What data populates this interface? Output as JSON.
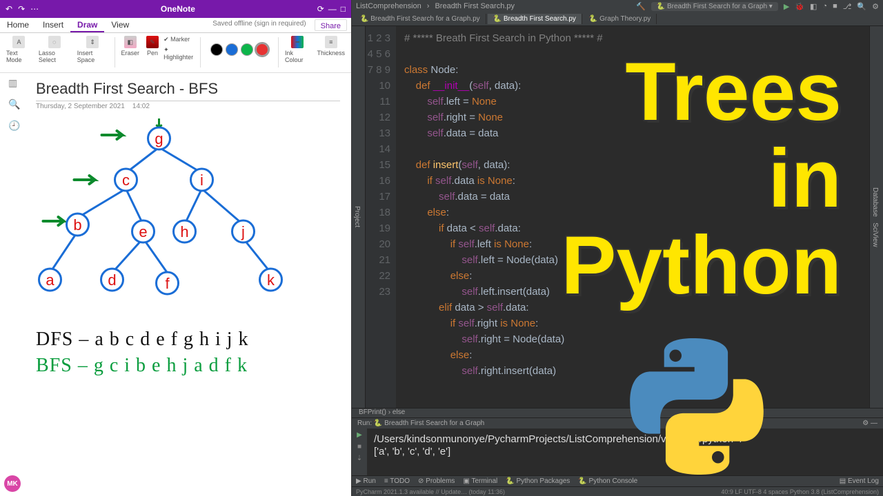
{
  "onenote": {
    "app_title": "OneNote",
    "tabs": [
      "Home",
      "Insert",
      "Draw",
      "View"
    ],
    "active_tab": "Draw",
    "save_status": "Saved offline (sign in required)",
    "share_label": "Share",
    "ribbon": {
      "text_mode": "Text Mode",
      "lasso": "Lasso Select",
      "insert_space": "Insert Space",
      "eraser": "Eraser",
      "pen": "Pen",
      "marker": "Marker",
      "highlighter": "Highlighter",
      "ink_colour": "Ink Colour",
      "thickness": "Thickness",
      "colors": [
        "#000000",
        "#1a6dd6",
        "#0db54b",
        "#e73232"
      ]
    },
    "note": {
      "title": "Breadth First Search - BFS",
      "date": "Thursday, 2 September 2021",
      "time": "14:02",
      "tree_nodes": [
        "g",
        "c",
        "i",
        "b",
        "e",
        "h",
        "j",
        "a",
        "d",
        "f",
        "k"
      ],
      "dfs_line": "DFS – a b c d e f g h i j k",
      "bfs_line": "BFS – g c i b e h j a d f k"
    },
    "user_initials": "MK"
  },
  "ide": {
    "crumb1": "ListComprehension",
    "crumb2": "Breadth First Search.py",
    "run_config": "Breadth First Search for a Graph",
    "tabs": [
      {
        "label": "Breadth First Search for a Graph.py",
        "active": false
      },
      {
        "label": "Breadth First Search.py",
        "active": true
      },
      {
        "label": "Graph Theory.py",
        "active": false
      }
    ],
    "left_gutter": "Project",
    "right_gutters": [
      "Database",
      "SciView"
    ],
    "code_lines": [
      {
        "n": 1,
        "html": "<span class='cmt'># ***** Breath First Search in Python ***** #</span>"
      },
      {
        "n": 2,
        "html": ""
      },
      {
        "n": 3,
        "html": "<span class='kw'>class</span> Node:"
      },
      {
        "n": 4,
        "html": "    <span class='kw'>def</span> <span class='mg'>__init__</span>(<span class='slf'>self</span>, data):"
      },
      {
        "n": 5,
        "html": "        <span class='slf'>self</span>.left = <span class='kw'>None</span>"
      },
      {
        "n": 6,
        "html": "        <span class='slf'>self</span>.right = <span class='kw'>None</span>"
      },
      {
        "n": 7,
        "html": "        <span class='slf'>self</span>.data = data"
      },
      {
        "n": 8,
        "html": ""
      },
      {
        "n": 9,
        "html": "    <span class='kw'>def</span> <span class='fn'>insert</span>(<span class='slf'>self</span>, data):"
      },
      {
        "n": 10,
        "html": "        <span class='kw'>if</span> <span class='slf'>self</span>.data <span class='kw'>is</span> <span class='kw'>None</span>:"
      },
      {
        "n": 11,
        "html": "            <span class='slf'>self</span>.data = data"
      },
      {
        "n": 12,
        "html": "        <span class='kw'>else</span>:"
      },
      {
        "n": 13,
        "html": "            <span class='kw'>if</span> data &lt; <span class='slf'>self</span>.data:"
      },
      {
        "n": 14,
        "html": "                <span class='kw'>if</span> <span class='slf'>self</span>.left <span class='kw'>is</span> <span class='kw'>None</span>:"
      },
      {
        "n": 15,
        "html": "                    <span class='slf'>self</span>.left = Node(data)"
      },
      {
        "n": 16,
        "html": "                <span class='kw'>else</span>:"
      },
      {
        "n": 17,
        "html": "                    <span class='slf'>self</span>.left.insert(data)"
      },
      {
        "n": 18,
        "html": "            <span class='kw'>elif</span> data &gt; <span class='slf'>self</span>.data:"
      },
      {
        "n": 19,
        "html": "                <span class='kw'>if</span> <span class='slf'>self</span>.right <span class='kw'>is</span> <span class='kw'>None</span>:"
      },
      {
        "n": 20,
        "html": "                    <span class='slf'>self</span>.right = Node(data)"
      },
      {
        "n": 21,
        "html": "                <span class='kw'>else</span>:"
      },
      {
        "n": 22,
        "html": "                    <span class='slf'>self</span>.right.insert(data)"
      },
      {
        "n": 23,
        "html": ""
      }
    ],
    "breadcrumb": "BFPrint()  ›  else",
    "run_title": "Run:",
    "run_tab": "Breadth First Search for a Graph",
    "console_line1": "/Users/kindsonmunonye/PycharmProjects/ListComprehension/venv/bin/python \"/",
    "console_line2": "['a', 'b', 'c', 'd', 'e']",
    "bottom_tabs": [
      "Run",
      "TODO",
      "Problems",
      "Terminal",
      "Python Packages",
      "Python Console"
    ],
    "event_log": "Event Log",
    "status_left": "PyCharm 2021.1.3 available // Update… (today 11:36)",
    "status_right": "40:9   LF   UTF-8   4 spaces   Python 3.8 (ListComprehension)"
  },
  "overlay": {
    "line1": "Trees",
    "line2": "in",
    "line3": "Python"
  }
}
